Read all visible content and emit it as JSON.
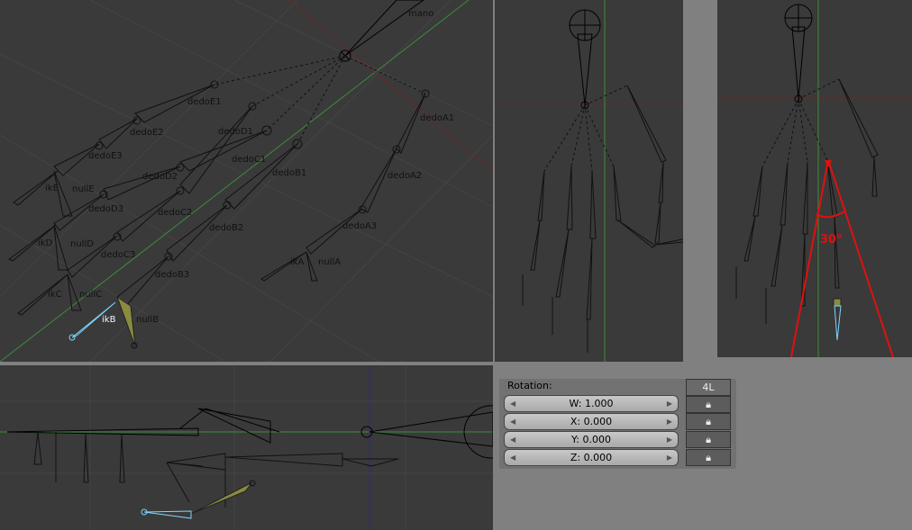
{
  "viewports": {
    "perspective": {
      "labels": {
        "mano": "mano",
        "dedoE1": "dedoE1",
        "dedoE2": "dedoE2",
        "dedoE3": "dedoE3",
        "ikE": "ikE",
        "nullE": "nullE",
        "dedoD1": "dedoD1",
        "dedoD2": "dedoD2",
        "dedoD3": "dedoD3",
        "ikD": "ikD",
        "nullD": "nullD",
        "dedoC1": "dedoC1",
        "dedoC2": "dedoC2",
        "dedoC3": "dedoC3",
        "ikC": "ikC",
        "nullC": "nullC",
        "dedoB1": "dedoB1",
        "dedoB2": "dedoB2",
        "dedoB3": "dedoB3",
        "ikB": "ikB",
        "nullB": "nullB",
        "dedoA1": "dedoA1",
        "dedoA2": "dedoA2",
        "dedoA3": "dedoA3",
        "ikA": "ikA",
        "nullA": "nullA"
      }
    },
    "angle_view": {
      "angle_label": "30°"
    }
  },
  "rotation_panel": {
    "title": "Rotation:",
    "layer_button": "4L",
    "fields": [
      {
        "label": "W: 1.000"
      },
      {
        "label": "X: 0.000"
      },
      {
        "label": "Y: 0.000"
      },
      {
        "label": "Z: 0.000"
      }
    ]
  },
  "colors": {
    "viewport_bg": "#3a3a3a",
    "selected_bone": "#7fd6ff",
    "active_bone": "#8a8a40",
    "angle": "#e01010",
    "grid_axis_green": "#3c8c3c",
    "grid_axis_red": "#7a2a2a"
  }
}
